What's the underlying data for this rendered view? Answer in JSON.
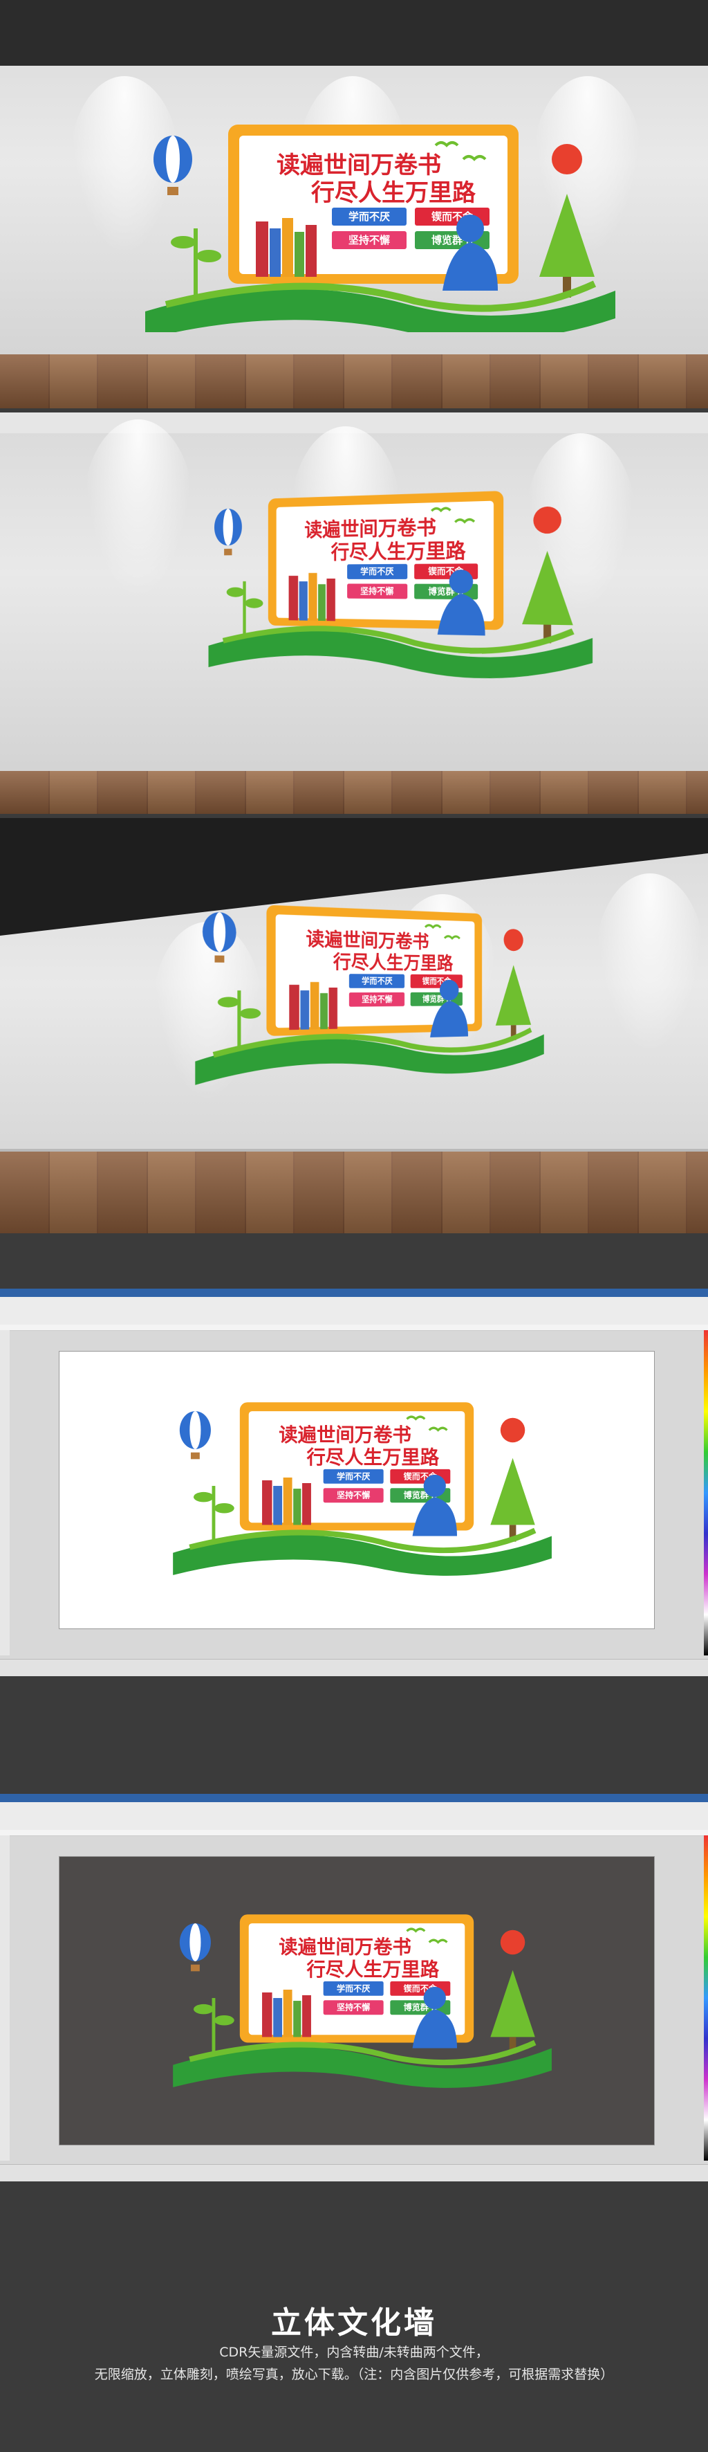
{
  "signage": {
    "line1": "读遍世间万卷书",
    "line2": "行尽人生万里路",
    "tags": [
      "学而不厌",
      "锲而不舍",
      "坚持不懈",
      "博览群书"
    ]
  },
  "footer": {
    "title": "立体文化墙",
    "line1": "CDR矢量源文件，内含转曲/未转曲两个文件，",
    "line2": "无限缩放，立体雕刻，喷绘写真，放心下载。（注：内含图片仅供参考，可根据需求替换）"
  },
  "colors": {
    "frame": "#f7a823",
    "red_text": "#d9232d",
    "green_text": "#2e9e37",
    "blue_figure": "#2f6fd0",
    "green_leaf": "#6fbf2f",
    "sun": "#e8402e",
    "tag_blue": "#2f6fd0",
    "tag_red": "#e0283a",
    "tag_pink": "#e83c6e",
    "tag_green": "#3aa24a"
  }
}
